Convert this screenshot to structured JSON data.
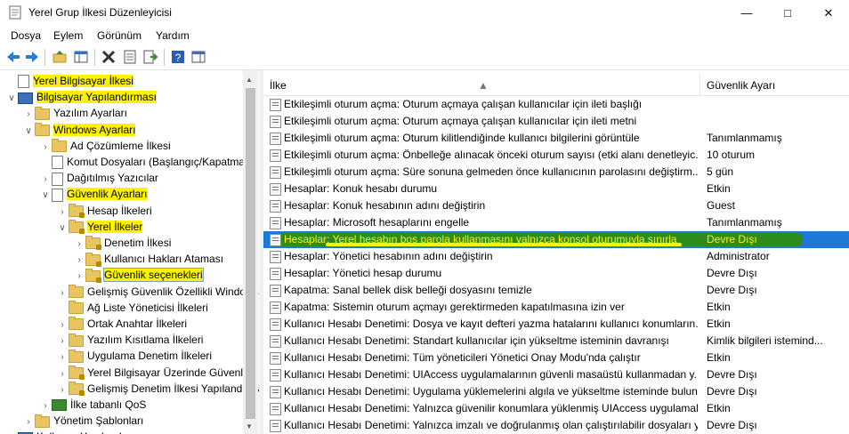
{
  "window": {
    "title": "Yerel Grup İlkesi Düzenleyicisi"
  },
  "menu": [
    "Dosya",
    "Eylem",
    "Görünüm",
    "Yardım"
  ],
  "tree": [
    {
      "label": "Yerel Bilgisayar İlkesi",
      "level": 0,
      "exp": "",
      "icon": "doc",
      "hl": true
    },
    {
      "label": "Bilgisayar Yapılandırması",
      "level": 0,
      "exp": "v",
      "icon": "pc",
      "hl": true
    },
    {
      "label": "Yazılım Ayarları",
      "level": 1,
      "exp": ">",
      "icon": "folder"
    },
    {
      "label": "Windows Ayarları",
      "level": 1,
      "exp": "v",
      "icon": "folder",
      "hl": true
    },
    {
      "label": "Ad Çözümleme İlkesi",
      "level": 2,
      "exp": ">",
      "icon": "folder"
    },
    {
      "label": "Komut Dosyaları (Başlangıç/Kapatma)",
      "level": 2,
      "exp": "",
      "icon": "doc"
    },
    {
      "label": "Dağıtılmış Yazıcılar",
      "level": 2,
      "exp": ">",
      "icon": "doc"
    },
    {
      "label": "Güvenlik Ayarları",
      "level": 2,
      "exp": "v",
      "icon": "doc",
      "hl": true
    },
    {
      "label": "Hesap İlkeleri",
      "level": 3,
      "exp": ">",
      "icon": "lock"
    },
    {
      "label": "Yerel İlkeler",
      "level": 3,
      "exp": "v",
      "icon": "lock",
      "hl": true
    },
    {
      "label": "Denetim İlkesi",
      "level": 4,
      "exp": ">",
      "icon": "lock"
    },
    {
      "label": "Kullanıcı Hakları Ataması",
      "level": 4,
      "exp": ">",
      "icon": "lock"
    },
    {
      "label": "Güvenlik seçenekleri",
      "level": 4,
      "exp": ">",
      "icon": "lock",
      "sel": true
    },
    {
      "label": "Gelişmiş Güvenlik Özellikli Windows Defender Güvenlik Duvarı",
      "level": 3,
      "exp": ">",
      "icon": "folder"
    },
    {
      "label": "Ağ Liste Yöneticisi İlkeleri",
      "level": 3,
      "exp": "",
      "icon": "folder"
    },
    {
      "label": "Ortak Anahtar İlkeleri",
      "level": 3,
      "exp": ">",
      "icon": "folder"
    },
    {
      "label": "Yazılım Kısıtlama İlkeleri",
      "level": 3,
      "exp": ">",
      "icon": "folder"
    },
    {
      "label": "Uygulama Denetim İlkeleri",
      "level": 3,
      "exp": ">",
      "icon": "folder"
    },
    {
      "label": "Yerel Bilgisayar Üzerinde Güvenlik",
      "level": 3,
      "exp": ">",
      "icon": "lock"
    },
    {
      "label": "Gelişmiş Denetim İlkesi Yapılandırması",
      "level": 3,
      "exp": ">",
      "icon": "lock"
    },
    {
      "label": "İlke tabanlı QoS",
      "level": 2,
      "exp": ">",
      "icon": "chart"
    },
    {
      "label": "Yönetim Şablonları",
      "level": 1,
      "exp": ">",
      "icon": "folder"
    },
    {
      "label": "Kullanıcı Yapılandırması",
      "level": 0,
      "exp": ">",
      "icon": "pc"
    }
  ],
  "list_header": {
    "policy": "İlke",
    "setting": "Güvenlik Ayarı"
  },
  "policies": [
    {
      "policy": "Etkileşimli oturum açma: Oturum açmaya çalışan kullanıcılar için ileti başlığı",
      "setting": ""
    },
    {
      "policy": "Etkileşimli oturum açma: Oturum açmaya çalışan kullanıcılar için ileti metni",
      "setting": ""
    },
    {
      "policy": "Etkileşimli oturum açma: Oturum kilitlendiğinde kullanıcı bilgilerini görüntüle",
      "setting": "Tanımlanmamış"
    },
    {
      "policy": "Etkileşimli oturum açma: Önbelleğe alınacak önceki oturum sayısı (etki alanı denetleyic...",
      "setting": "10 oturum"
    },
    {
      "policy": "Etkileşimli oturum açma: Süre sonuna gelmeden önce kullanıcının parolasını değiştirm...",
      "setting": "5 gün"
    },
    {
      "policy": "Hesaplar: Konuk hesabı durumu",
      "setting": "Etkin"
    },
    {
      "policy": "Hesaplar: Konuk hesabının adını değiştirin",
      "setting": "Guest"
    },
    {
      "policy": "Hesaplar: Microsoft hesaplarını engelle",
      "setting": "Tanımlanmamış"
    },
    {
      "policy": "Hesaplar: Yerel hesabın boş parola kullanmasını yalnızca konsol oturumuyla sınırla",
      "setting": "Devre Dışı",
      "selected": true
    },
    {
      "policy": "Hesaplar: Yönetici hesabının adını değiştirin",
      "setting": "Administrator"
    },
    {
      "policy": "Hesaplar: Yönetici hesap durumu",
      "setting": "Devre Dışı"
    },
    {
      "policy": "Kapatma: Sanal bellek disk belleği dosyasını temizle",
      "setting": "Devre Dışı"
    },
    {
      "policy": "Kapatma: Sistemin oturum açmayı gerektirmeden kapatılmasına izin ver",
      "setting": "Etkin"
    },
    {
      "policy": "Kullanıcı Hesabı Denetimi: Dosya ve kayıt defteri yazma hatalarını kullanıcı konumların...",
      "setting": "Etkin"
    },
    {
      "policy": "Kullanıcı Hesabı Denetimi: Standart kullanıcılar için yükseltme isteminin davranışı",
      "setting": "Kimlik bilgileri istemind..."
    },
    {
      "policy": "Kullanıcı Hesabı Denetimi: Tüm yöneticileri Yönetici Onay Modu'nda çalıştır",
      "setting": "Etkin"
    },
    {
      "policy": "Kullanıcı Hesabı Denetimi: UIAccess uygulamalarının güvenli masaüstü kullanmadan y...",
      "setting": "Devre Dışı"
    },
    {
      "policy": "Kullanıcı Hesabı Denetimi: Uygulama yüklemelerini algıla ve yükseltme isteminde bulun",
      "setting": "Devre Dışı"
    },
    {
      "policy": "Kullanıcı Hesabı Denetimi: Yalnızca güvenilir konumlara yüklenmiş UIAccess uygulamal...",
      "setting": "Etkin"
    },
    {
      "policy": "Kullanıcı Hesabı Denetimi: Yalnızca imzalı ve doğrulanmış olan çalıştırılabilir dosyaları y...",
      "setting": "Devre Dışı"
    }
  ]
}
